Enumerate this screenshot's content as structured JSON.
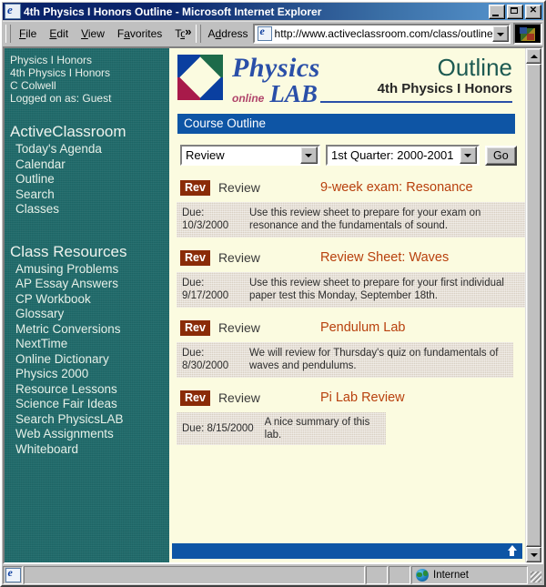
{
  "window": {
    "title": "4th Physics I Honors Outline - Microsoft Internet Explorer",
    "icon": "ie-document-icon",
    "buttons": {
      "minimize": "_",
      "maximize": "□",
      "close": "✕"
    }
  },
  "menu": {
    "items": [
      "File",
      "Edit",
      "View",
      "Favorites",
      "T̲"
    ],
    "overflow": "»"
  },
  "toolbar": {
    "address_label": "Address",
    "url": "http://www.activeclassroom.com/class/outline.asp",
    "url_placeholder": "Address",
    "dropdown_icon": "chevron-down-icon",
    "brand_logo": "windows-flag-logo"
  },
  "sidebar": {
    "meta": [
      "Physics I Honors",
      "4th Physics I Honors",
      "C Colwell",
      "Logged on as: Guest"
    ],
    "sections": [
      {
        "heading": "ActiveClassroom",
        "items": [
          "Today's Agenda",
          "Calendar",
          "Outline",
          "Search",
          "Classes"
        ]
      },
      {
        "heading": "Class Resources",
        "items": [
          "Amusing Problems",
          "AP Essay Answers",
          "CP Workbook",
          "Glossary",
          "Metric Conversions",
          "NextTime",
          "Online Dictionary",
          "Physics 2000",
          "Resource Lessons",
          "Science Fair Ideas",
          "Search PhysicsLAB",
          "Web Assignments",
          "Whiteboard"
        ]
      }
    ]
  },
  "header": {
    "logo_alt": "physicslab-diamond-logo",
    "brand_line1": "Physics",
    "brand_online": "online",
    "brand_lab": "LAB",
    "page_title": "Outline",
    "course_name": "4th Physics I Honors"
  },
  "section_bar": {
    "label": "Course Outline"
  },
  "controls": {
    "type_select": {
      "value": "Review"
    },
    "quarter_select": {
      "value": "1st Quarter: 2000-2001"
    },
    "go_button": "Go"
  },
  "entries": [
    {
      "badge": "Rev",
      "type": "Review",
      "title": "9-week exam: Resonance",
      "due_label": "Due:",
      "due_date": "10/3/2000",
      "description": "Use this review sheet to prepare for your exam on resonance and the fundamentals of sound.",
      "width": "w-full",
      "inline": false
    },
    {
      "badge": "Rev",
      "type": "Review",
      "title": "Review Sheet: Waves",
      "due_label": "Due:",
      "due_date": "9/17/2000",
      "description": "Use this review sheet to prepare for your first individual paper test this Monday, September 18th.",
      "width": "w-full",
      "inline": false
    },
    {
      "badge": "Rev",
      "type": "Review",
      "title": "Pendulum Lab",
      "due_label": "Due:",
      "due_date": "8/30/2000",
      "description": "We will review for Thursday's quiz on fundamentals of waves and pendulums.",
      "width": "w-mid",
      "inline": false
    },
    {
      "badge": "Rev",
      "type": "Review",
      "title": "Pi Lab Review",
      "due_label": "Due: 8/15/2000",
      "due_date": "",
      "description": "A nice summary of this lab.",
      "width": "w-sm",
      "inline": true
    }
  ],
  "footer": {
    "top_arrow_icon": "scroll-to-top-arrow-icon"
  },
  "scrollbar": {
    "up_icon": "scroll-up-arrow-icon",
    "down_icon": "scroll-down-arrow-icon"
  },
  "statusbar": {
    "doc_icon": "ie-document-icon",
    "message": "",
    "zone_icon": "internet-globe-icon",
    "zone": "Internet"
  },
  "colors": {
    "titlebar_blue": "#0a246a",
    "sidebar_teal": "#1f6b6b",
    "section_blue": "#0e55a5",
    "badge_maroon": "#8a2b08",
    "entry_title_orange": "#b8400d",
    "page_cream": "#fbfbe0",
    "desc_tan": "#d8cfc2",
    "brand_blue": "#2a4fa8",
    "heading_green": "#1d5a52"
  }
}
